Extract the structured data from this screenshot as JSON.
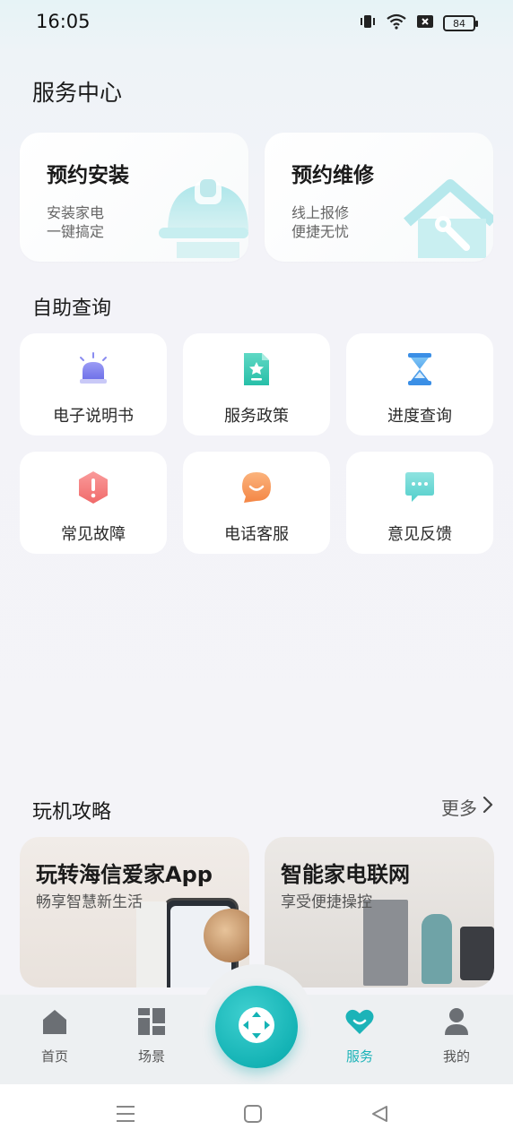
{
  "status": {
    "time": "16:05",
    "battery": "84"
  },
  "page_title": "服务中心",
  "hero_cards": [
    {
      "title": "预约安装",
      "line1": "安装家电",
      "line2": "一键搞定",
      "icon": "helmet-icon"
    },
    {
      "title": "预约维修",
      "line1": "线上报修",
      "line2": "便捷无忧",
      "icon": "house-wrench-icon"
    }
  ],
  "self_service": {
    "title": "自助查询",
    "items": [
      {
        "label": "电子说明书",
        "icon": "alarm-light-icon"
      },
      {
        "label": "服务政策",
        "icon": "document-star-icon"
      },
      {
        "label": "进度查询",
        "icon": "hourglass-icon"
      },
      {
        "label": "常见故障",
        "icon": "warning-hexagon-icon"
      },
      {
        "label": "电话客服",
        "icon": "chat-smile-icon"
      },
      {
        "label": "意见反馈",
        "icon": "feedback-bubble-icon"
      }
    ]
  },
  "guides": {
    "title": "玩机攻略",
    "more": "更多",
    "cards": [
      {
        "title": "玩转海信爱家App",
        "subtitle": "畅享智慧新生活"
      },
      {
        "title": "智能家电联网",
        "subtitle": "享受便捷操控"
      }
    ]
  },
  "tabbar": {
    "tabs": [
      {
        "label": "首页",
        "icon": "home-icon"
      },
      {
        "label": "场景",
        "icon": "grid-layout-icon"
      },
      {
        "label": "服务",
        "icon": "heart-smile-icon"
      },
      {
        "label": "我的",
        "icon": "person-icon"
      }
    ],
    "active": "服务",
    "fab_icon": "direction-pad-icon"
  },
  "colors": {
    "accent": "#1cb3b8",
    "card": "#ffffff",
    "background": "#f4f4f8"
  }
}
